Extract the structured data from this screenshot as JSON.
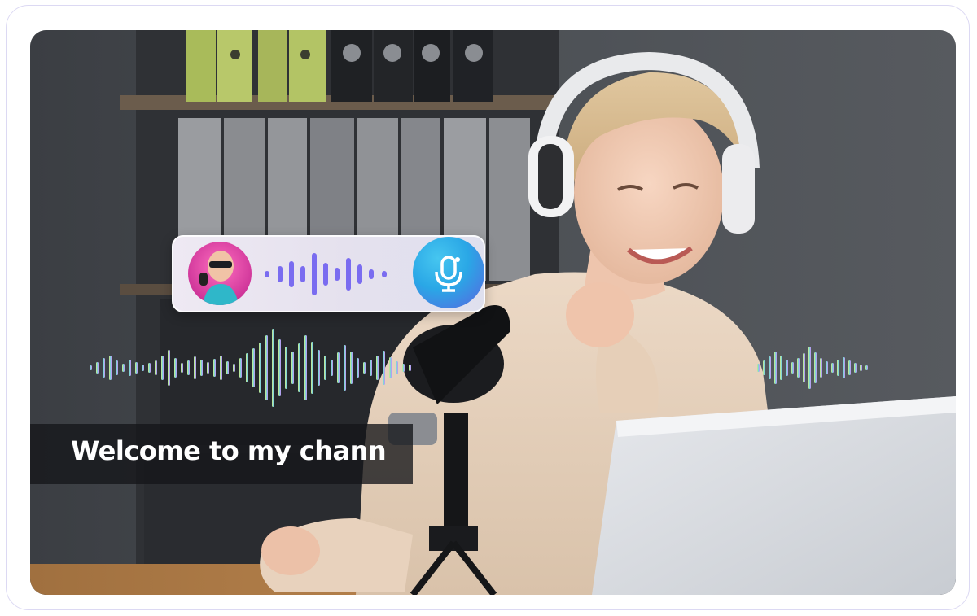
{
  "caption": {
    "text": "Welcome to my chann"
  },
  "voice_widget": {
    "avatar_icon": "singer-avatar-icon",
    "wave_icon": "audio-waveform-icon",
    "mic_icon": "microphone-icon",
    "mic_gradient": [
      "#46c6f0",
      "#5a63e0"
    ]
  },
  "colors": {
    "card_border": "#dcd9f3",
    "wave_left": "#f2e58a",
    "wave_mid": "#6fe0d0",
    "wave_right": "#c08ef0"
  }
}
